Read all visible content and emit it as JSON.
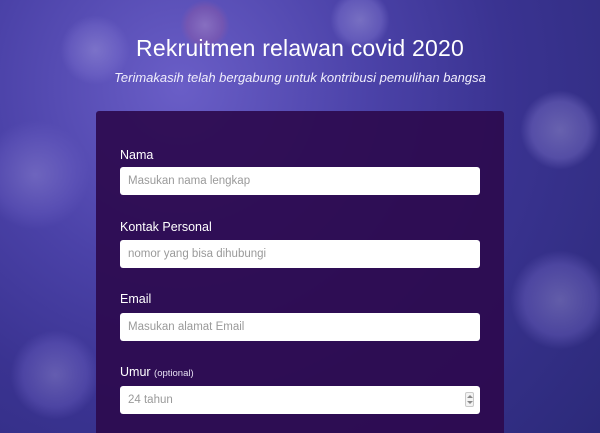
{
  "header": {
    "title": "Rekruitmen relawan covid 2020",
    "subtitle": "Terimakasih telah bergabung untuk kontribusi pemulihan bangsa"
  },
  "form": {
    "fields": [
      {
        "label": "Nama",
        "placeholder": "Masukan nama lengkap"
      },
      {
        "label": "Kontak Personal",
        "placeholder": "nomor yang bisa dihubungi"
      },
      {
        "label": "Email",
        "placeholder": "Masukan alamat Email"
      },
      {
        "label": "Umur",
        "optional": "(optional)",
        "placeholder": "24 tahun"
      }
    ]
  },
  "colors": {
    "background": "#4b42a8",
    "panel": "#2c0a4e",
    "text": "#ffffff"
  },
  "icons": {
    "number_spinner": "stepper-icon"
  }
}
